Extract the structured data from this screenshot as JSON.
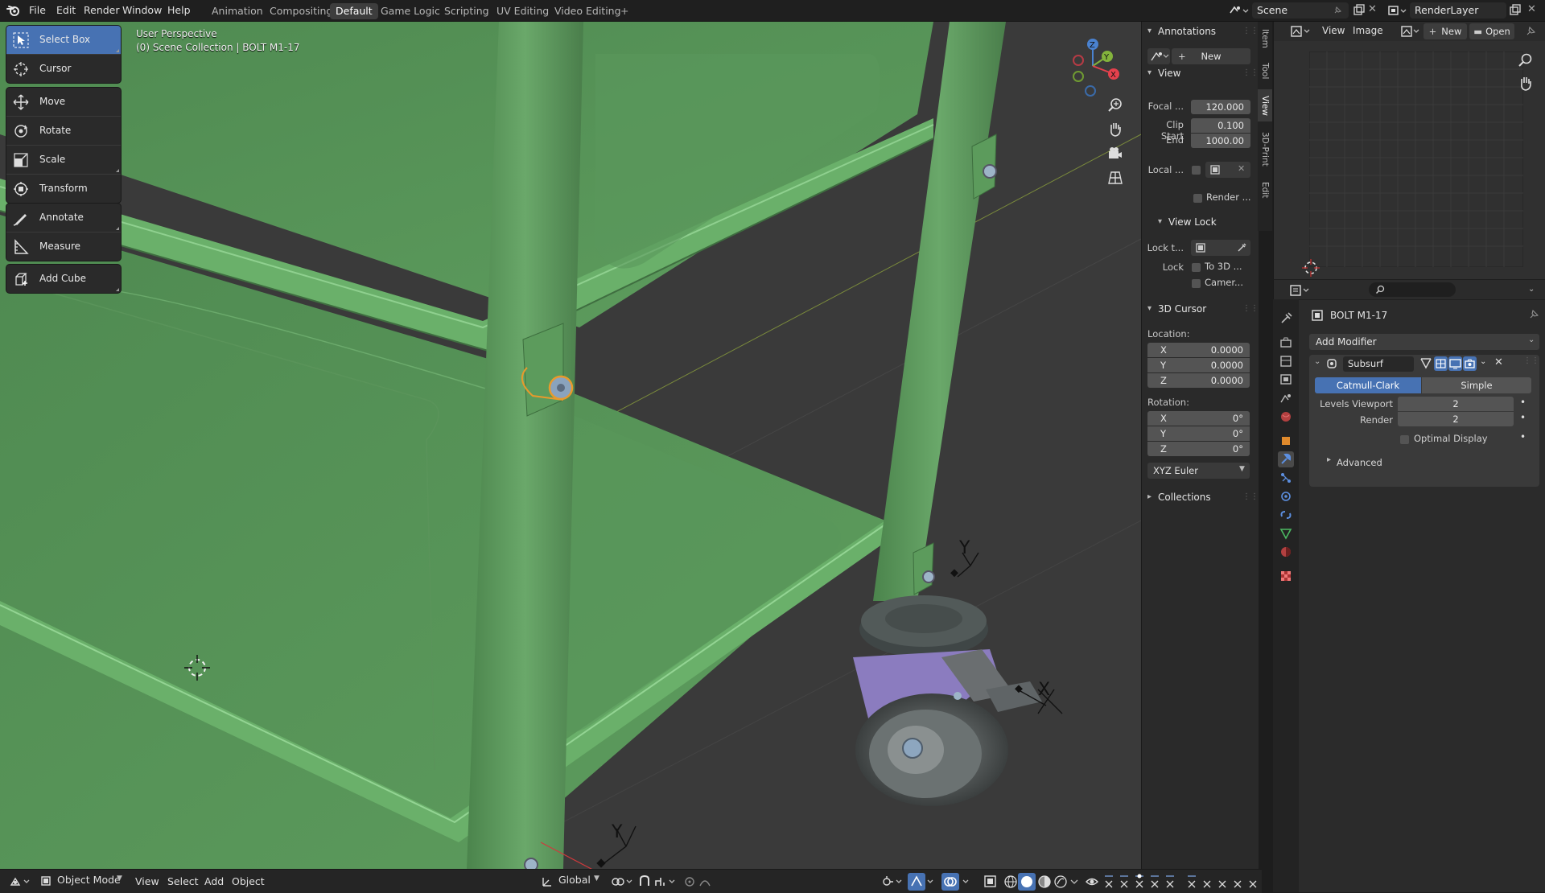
{
  "topbar": {
    "menus": [
      "File",
      "Edit",
      "Render",
      "Window",
      "Help"
    ],
    "workspaces": [
      "Animation",
      "Compositing",
      "Default",
      "Game Logic",
      "Scripting",
      "UV Editing",
      "Video Editing"
    ],
    "active_workspace": "Default",
    "add_workspace": "+",
    "scene": "Scene",
    "view_layer": "RenderLayer"
  },
  "toolbar": {
    "tools": [
      {
        "label": "Select Box",
        "icon": "select-box-icon",
        "active": true
      },
      {
        "label": "Cursor",
        "icon": "cursor-icon"
      },
      {
        "label": "Move",
        "icon": "move-icon"
      },
      {
        "label": "Rotate",
        "icon": "rotate-icon"
      },
      {
        "label": "Scale",
        "icon": "scale-icon"
      },
      {
        "label": "Transform",
        "icon": "transform-icon"
      },
      {
        "label": "Annotate",
        "icon": "annotate-icon"
      },
      {
        "label": "Measure",
        "icon": "measure-icon"
      },
      {
        "label": "Add Cube",
        "icon": "add-cube-icon"
      }
    ]
  },
  "viewport": {
    "perspective": "User Perspective",
    "collection": "(0) Scene Collection | BOLT M1-17",
    "gizmo_axes": [
      "X",
      "Y",
      "Z"
    ],
    "empty_labels": [
      "Y",
      "X",
      "Y"
    ]
  },
  "npanel": {
    "annotations": {
      "title": "Annotations",
      "new_label": "New"
    },
    "view": {
      "title": "View",
      "focal_label": "Focal ...",
      "focal_value": "120.000",
      "clip_start_label": "Clip Start",
      "clip_start_value": "0.100",
      "end_label": "End",
      "end_value": "1000.00",
      "local_label": "Local ...",
      "render_label": "Render ..."
    },
    "view_lock": {
      "title": "View Lock",
      "lock_to_label": "Lock t...",
      "lock_label": "Lock",
      "to_3d": "To 3D ...",
      "camera": "Camer..."
    },
    "cursor": {
      "title": "3D Cursor",
      "location_label": "Location:",
      "location": [
        {
          "axis": "X",
          "value": "0.0000"
        },
        {
          "axis": "Y",
          "value": "0.0000"
        },
        {
          "axis": "Z",
          "value": "0.0000"
        }
      ],
      "rotation_label": "Rotation:",
      "rotation": [
        {
          "axis": "X",
          "value": "0°"
        },
        {
          "axis": "Y",
          "value": "0°"
        },
        {
          "axis": "Z",
          "value": "0°"
        }
      ],
      "rotation_mode": "XYZ Euler"
    },
    "collections": {
      "title": "Collections"
    },
    "tabs": [
      "Item",
      "Tool",
      "View",
      "3D-Print",
      "Edit"
    ],
    "active_tab": "View"
  },
  "image_editor": {
    "view": "View",
    "image": "Image",
    "new": "New",
    "open": "Open"
  },
  "properties": {
    "object_name": "BOLT M1-17",
    "add_modifier": "Add Modifier",
    "modifier": {
      "name": "Subsurf",
      "catmull": "Catmull-Clark",
      "simple": "Simple",
      "levels_viewport_label": "Levels Viewport",
      "levels_viewport": "2",
      "render_label": "Render",
      "render": "2",
      "optimal_display": "Optimal Display",
      "advanced": "Advanced"
    }
  },
  "bottombar": {
    "mode": "Object Mode",
    "menus": [
      "View",
      "Select",
      "Add",
      "Object"
    ],
    "orientation": "Global"
  },
  "colors": {
    "accent": "#4772b3",
    "tray_green": "#5c9a5c",
    "caster_purple": "#8a78b8",
    "x_axis": "#e5414d",
    "y_axis": "#83b33c",
    "z_axis": "#4a82d0"
  }
}
